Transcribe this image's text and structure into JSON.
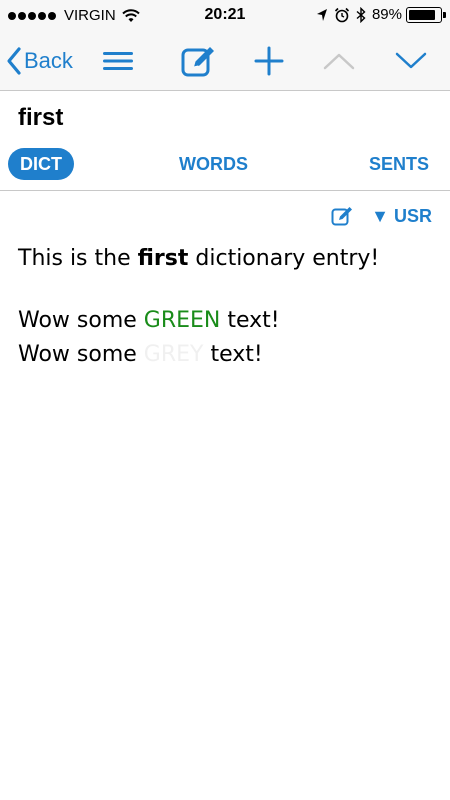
{
  "status_bar": {
    "carrier": "VIRGIN",
    "time": "20:21",
    "battery_percent": "89%",
    "battery_level": 0.89
  },
  "nav": {
    "back_label": "Back"
  },
  "entry": {
    "title": "first",
    "line1_pre": "This is the ",
    "line1_bold": "first",
    "line1_post": " dictionary entry!",
    "line2_pre": "Wow some ",
    "line2_colored": "GREEN",
    "line2_post": " text!",
    "line3_pre": "Wow some ",
    "line3_colored": "GREY",
    "line3_post": " text!"
  },
  "tabs": [
    {
      "label": "DICT",
      "active": true
    },
    {
      "label": "WORDS",
      "active": false
    },
    {
      "label": "SENTS",
      "active": false
    }
  ],
  "source": {
    "label": "▼ USR"
  },
  "colors": {
    "accent": "#1f7fcc",
    "green_text": "#1a8c1a",
    "grey_text": "#f0f0f0",
    "bar_background": "#f7f7f7"
  },
  "icons": {
    "back": "chevron-left-icon",
    "menu": "hamburger-menu-icon",
    "edit": "edit-pencil-icon",
    "add": "plus-icon",
    "up": "chevron-up-icon",
    "down": "chevron-down-icon"
  }
}
